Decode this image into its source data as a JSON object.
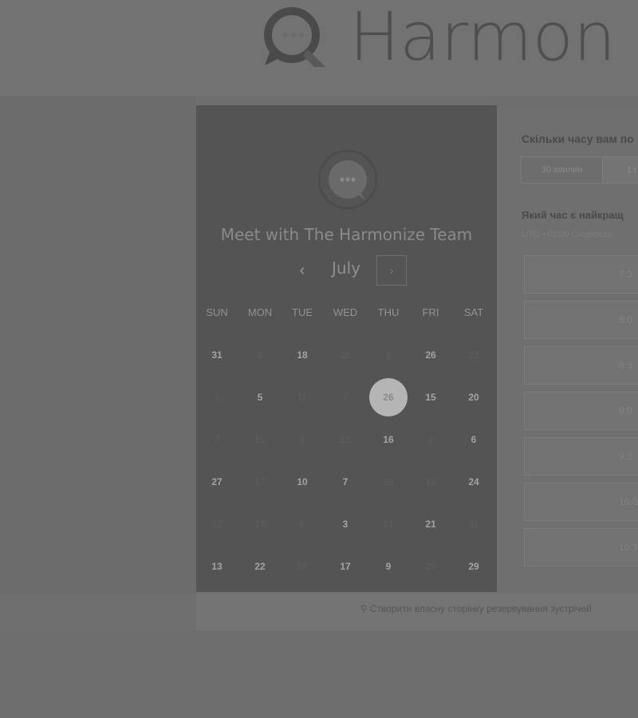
{
  "brand": {
    "name": "Harmon"
  },
  "calendar": {
    "title": "Meet with The Harmonize Team",
    "month": "July",
    "prev_label": "‹",
    "next_label": "›",
    "weekdays": [
      "SUN",
      "MON",
      "TUE",
      "WED",
      "THU",
      "FRI",
      "SAT"
    ],
    "weeks": [
      [
        {
          "d": "31",
          "a": true
        },
        {
          "d": "8",
          "a": false
        },
        {
          "d": "18",
          "a": true
        },
        {
          "d": "26",
          "a": false
        },
        {
          "d": "9",
          "a": false
        },
        {
          "d": "26",
          "a": true
        },
        {
          "d": "22",
          "a": false
        }
      ],
      [
        {
          "d": "1",
          "a": false
        },
        {
          "d": "5",
          "a": true
        },
        {
          "d": "11",
          "a": false
        },
        {
          "d": "7",
          "a": false
        },
        {
          "d": "26",
          "a": true,
          "selected": true
        },
        {
          "d": "15",
          "a": true
        },
        {
          "d": "20",
          "a": true
        }
      ],
      [
        {
          "d": "7",
          "a": false
        },
        {
          "d": "15",
          "a": false
        },
        {
          "d": "2",
          "a": false
        },
        {
          "d": "13",
          "a": false
        },
        {
          "d": "16",
          "a": true
        },
        {
          "d": "3",
          "a": false
        },
        {
          "d": "6",
          "a": true
        }
      ],
      [
        {
          "d": "27",
          "a": true
        },
        {
          "d": "17",
          "a": false
        },
        {
          "d": "10",
          "a": true
        },
        {
          "d": "7",
          "a": true
        },
        {
          "d": "29",
          "a": false
        },
        {
          "d": "12",
          "a": false
        },
        {
          "d": "24",
          "a": true
        }
      ],
      [
        {
          "d": "12",
          "a": false
        },
        {
          "d": "17",
          "a": false
        },
        {
          "d": "8",
          "a": false
        },
        {
          "d": "3",
          "a": true
        },
        {
          "d": "21",
          "a": false
        },
        {
          "d": "21",
          "a": true
        },
        {
          "d": "31",
          "a": false
        }
      ],
      [
        {
          "d": "13",
          "a": true
        },
        {
          "d": "22",
          "a": true
        },
        {
          "d": "26",
          "a": false
        },
        {
          "d": "17",
          "a": true
        },
        {
          "d": "9",
          "a": true
        },
        {
          "d": "20",
          "a": false
        },
        {
          "d": "29",
          "a": true
        }
      ]
    ]
  },
  "booking": {
    "duration_question": "Скільки часу вам по",
    "durations": [
      "30 хвилин",
      "1 г"
    ],
    "time_question": "Який час є найкращ",
    "timezone": "UTC +03:00 Східноєвр",
    "slots": [
      "7:3",
      "8:0",
      "8:3",
      "9:0",
      "9:3",
      "10:0",
      "10:3"
    ]
  },
  "footer": {
    "link": "Створити власну сторінку резервування зустрічей"
  },
  "colors": {
    "selected_day": "#b5b5b5",
    "panel": "#545454"
  }
}
